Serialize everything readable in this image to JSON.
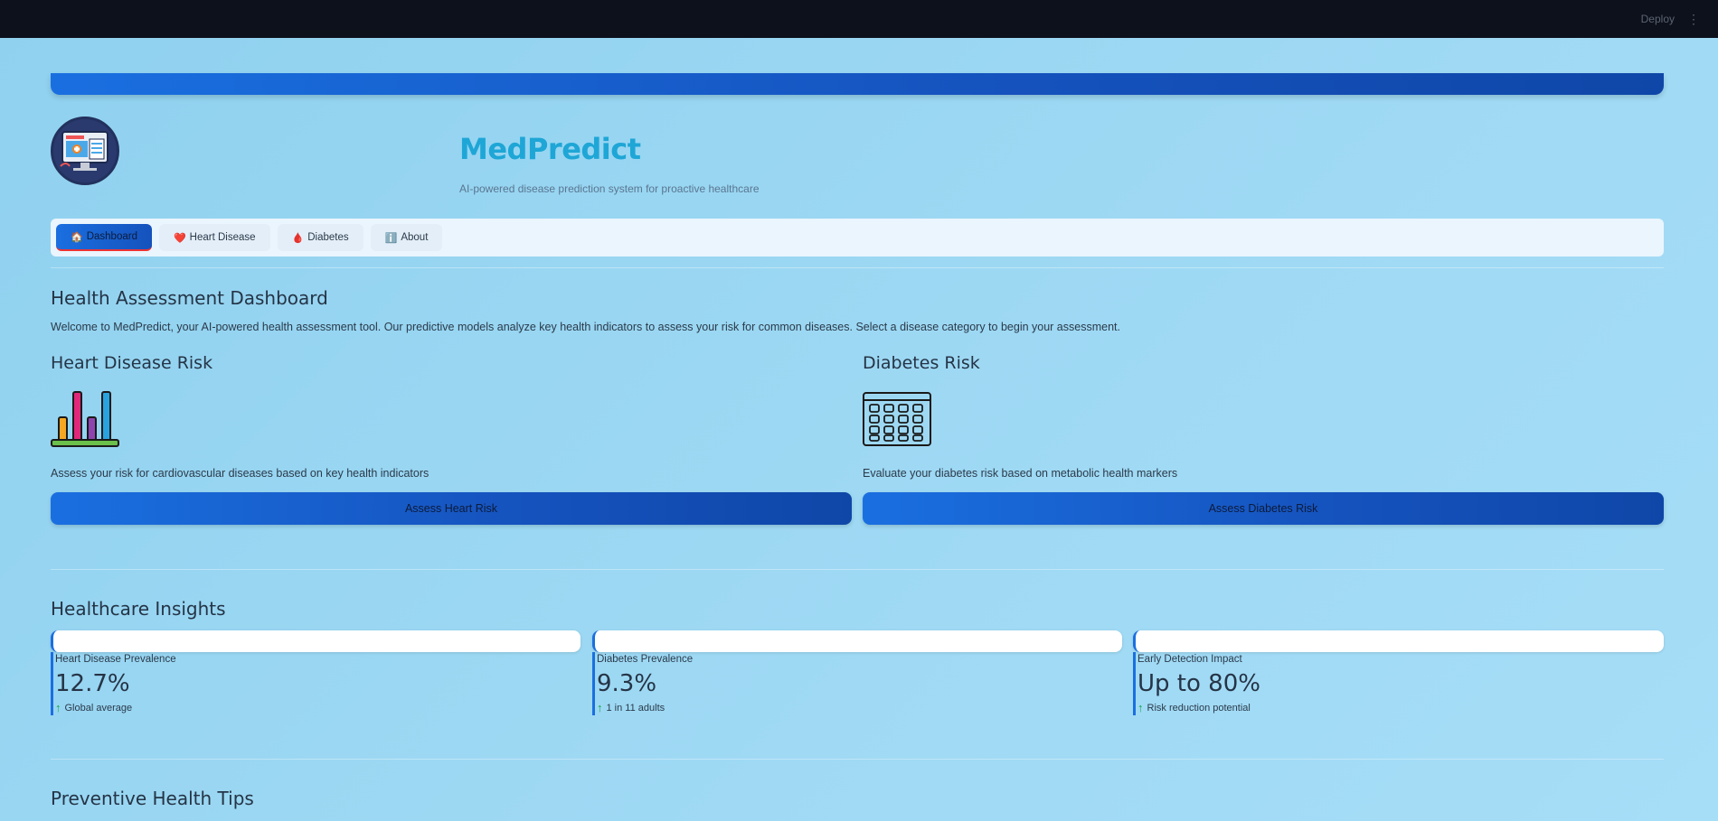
{
  "topbar": {
    "deploy_label": "Deploy",
    "menu_glyph": "⋮"
  },
  "header": {
    "title": "MedPredict",
    "subtitle": "AI-powered disease prediction system for proactive healthcare",
    "logo_icon": "medical-monitor-icon"
  },
  "nav": {
    "tabs": [
      {
        "label": "Dashboard",
        "icon": "🏠",
        "active": true
      },
      {
        "label": "Heart Disease",
        "icon": "❤️",
        "active": false
      },
      {
        "label": "Diabetes",
        "icon": "🩸",
        "active": false
      },
      {
        "label": "About",
        "icon": "ℹ️",
        "active": false
      }
    ]
  },
  "dashboard": {
    "title": "Health Assessment Dashboard",
    "intro": "Welcome to MedPredict, your AI-powered health assessment tool. Our predictive models analyze key health indicators to assess your risk for common diseases. Select a disease category to begin your assessment."
  },
  "cards": {
    "heart": {
      "title": "Heart Disease Risk",
      "description": "Assess your risk for cardiovascular diseases based on key health indicators",
      "button": "Assess Heart Risk",
      "icon": "bar-chart-icon"
    },
    "diabetes": {
      "title": "Diabetes Risk",
      "description": "Evaluate your diabetes risk based on metabolic health markers",
      "button": "Assess Diabetes Risk",
      "icon": "calendar-grid-icon"
    }
  },
  "insights": {
    "title": "Healthcare Insights",
    "metrics": [
      {
        "label": "Heart Disease Prevalence",
        "value": "12.7%",
        "delta": "Global average"
      },
      {
        "label": "Diabetes Prevalence",
        "value": "9.3%",
        "delta": "1 in 11 adults"
      },
      {
        "label": "Early Detection Impact",
        "value": "Up to 80%",
        "delta": "Risk reduction potential"
      }
    ]
  },
  "tips": {
    "title": "Preventive Health Tips"
  },
  "colors": {
    "accent": "#1a6fe0",
    "title": "#1ea6d6",
    "topbar": "#0d111c",
    "delta": "#17a34a"
  }
}
